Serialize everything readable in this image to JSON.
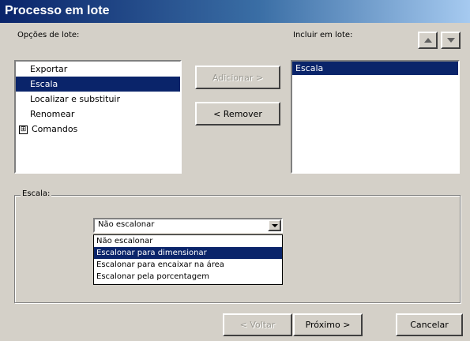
{
  "window": {
    "title": "Processo em lote"
  },
  "options": {
    "label": "Opções de lote:",
    "items": [
      {
        "label": "Exportar",
        "selected": false,
        "expandable": false
      },
      {
        "label": "Escala",
        "selected": true,
        "expandable": false
      },
      {
        "label": "Localizar e substituir",
        "selected": false,
        "expandable": false
      },
      {
        "label": "Renomear",
        "selected": false,
        "expandable": false
      },
      {
        "label": "Comandos",
        "selected": false,
        "expandable": true,
        "expander": "⊞"
      }
    ]
  },
  "include": {
    "label": "Incluir em lote:",
    "items": [
      {
        "label": "Escala",
        "selected": true
      }
    ],
    "move_up_icon": "arrow-up-icon",
    "move_down_icon": "arrow-down-icon"
  },
  "actions": {
    "add_label": "Adicionar >",
    "remove_label": "< Remover"
  },
  "scale_group": {
    "label": "Escala:",
    "selected_value": "Não escalonar",
    "options": [
      {
        "label": "Não escalonar",
        "highlighted": false
      },
      {
        "label": "Escalonar para dimensionar",
        "highlighted": true
      },
      {
        "label": "Escalonar para encaixar na área",
        "highlighted": false
      },
      {
        "label": "Escalonar pela porcentagem",
        "highlighted": false
      }
    ]
  },
  "footer": {
    "back_label": "< Voltar",
    "next_label": "Próximo >",
    "cancel_label": "Cancelar"
  },
  "colors": {
    "selection": "#0a246a",
    "face": "#d4d0c8",
    "title_start": "#0a246a",
    "title_end": "#a6caf0"
  }
}
